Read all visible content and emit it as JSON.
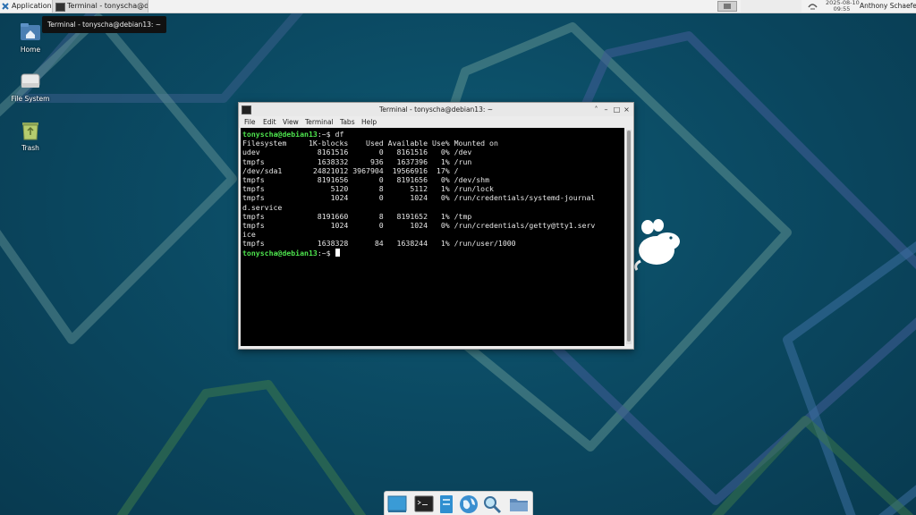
{
  "panel": {
    "apps_label": "Applications",
    "task_label": "Terminal - tonyscha@de...",
    "clock_date": "2025-08-10",
    "clock_time": "09:55",
    "user": "Anthony Schaefer"
  },
  "tooltip": "Terminal - tonyscha@debian13: ~",
  "desktop_icons": [
    {
      "label": "Home",
      "icon": "home-folder-icon"
    },
    {
      "label": "File System",
      "icon": "drive-icon"
    },
    {
      "label": "Trash",
      "icon": "trash-icon"
    }
  ],
  "terminal": {
    "title": "Terminal - tonyscha@debian13: ~",
    "menu": [
      "File",
      "Edit",
      "View",
      "Terminal",
      "Tabs",
      "Help"
    ],
    "prompt": "tonyscha@debian13",
    "prompt_suffix": ":~$ ",
    "command": "df",
    "output": [
      "Filesystem     1K-blocks    Used Available Use% Mounted on",
      "udev             8161516       0   8161516   0% /dev",
      "tmpfs            1638332     936   1637396   1% /run",
      "/dev/sda1       24821012 3967904  19566916  17% /",
      "tmpfs            8191656       0   8191656   0% /dev/shm",
      "tmpfs               5120       8      5112   1% /run/lock",
      "tmpfs               1024       0      1024   0% /run/credentials/systemd-journal",
      "d.service",
      "tmpfs            8191660       8   8191652   1% /tmp",
      "tmpfs               1024       0      1024   0% /run/credentials/getty@tty1.serv",
      "ice",
      "tmpfs            1638328      84   1638244   1% /run/user/1000"
    ]
  },
  "dock": [
    "show-desktop-icon",
    "terminal-icon",
    "file-manager-icon",
    "web-browser-icon",
    "app-finder-icon",
    "folder-icon"
  ],
  "colors": {
    "prompt": "#4de34d",
    "desktop_bg": "#0b4a63",
    "terminal_bg": "#000000"
  }
}
